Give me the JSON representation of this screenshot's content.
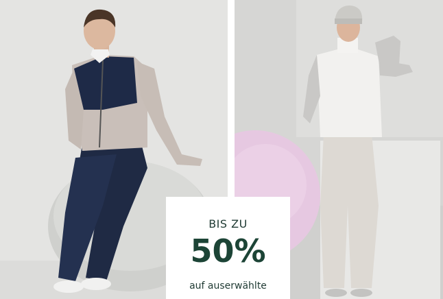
{
  "promo": {
    "line1": "BIS ZU",
    "discount": "50%",
    "line3": "auf auserwählte"
  },
  "colors": {
    "accent": "#1c4436",
    "background": "#ffffff"
  }
}
